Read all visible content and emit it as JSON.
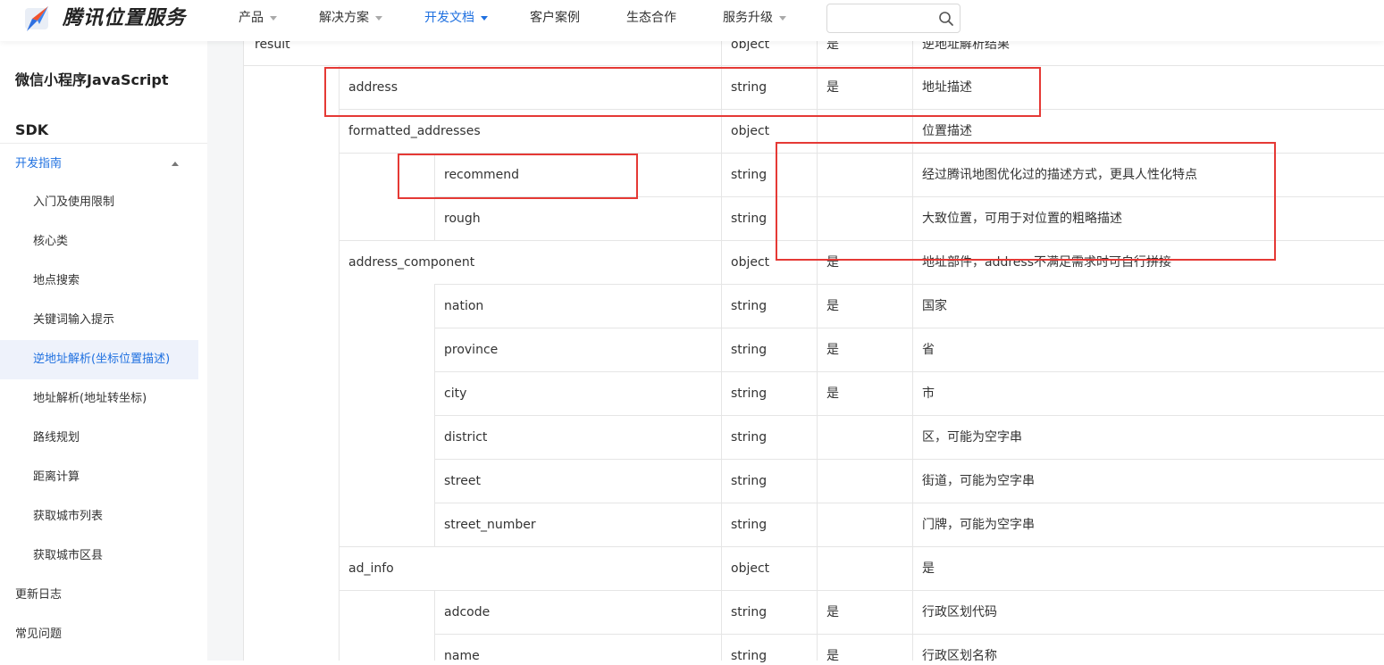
{
  "header": {
    "brand": "腾讯位置服务",
    "nav": [
      {
        "label": "产品",
        "has_caret": true,
        "active": false
      },
      {
        "label": "解决方案",
        "has_caret": true,
        "active": false
      },
      {
        "label": "开发文档",
        "has_caret": true,
        "active": true
      },
      {
        "label": "客户案例",
        "has_caret": false,
        "active": false
      },
      {
        "label": "生态合作",
        "has_caret": false,
        "active": false
      },
      {
        "label": "服务升级",
        "has_caret": true,
        "active": false
      }
    ],
    "search_placeholder": "",
    "accent_color": "#1f70e0"
  },
  "sidebar": {
    "title_line1": "微信小程序JavaScript",
    "title_line2": "SDK",
    "section": "开发指南",
    "items": [
      "入门及使用限制",
      "核心类",
      "地点搜索",
      "关键词输入提示",
      "逆地址解析(坐标位置描述)",
      "地址解析(地址转坐标)",
      "路线规划",
      "距离计算",
      "获取城市列表",
      "获取城市区县"
    ],
    "active_item": "逆地址解析(坐标位置描述)",
    "bottom_items": [
      "更新日志",
      "常见问题"
    ]
  },
  "table": {
    "rows": [
      {
        "name": "result",
        "type": "object",
        "required": "是",
        "desc": "逆地址解析结果"
      },
      {
        "name": "address",
        "type": "string",
        "required": "是",
        "desc": "地址描述"
      },
      {
        "name": "formatted_addresses",
        "type": "object",
        "required": "",
        "desc": "位置描述"
      },
      {
        "name": "recommend",
        "type": "string",
        "required": "",
        "desc": "经过腾讯地图优化过的描述方式，更具人性化特点"
      },
      {
        "name": "rough",
        "type": "string",
        "required": "",
        "desc": "大致位置，可用于对位置的粗略描述"
      },
      {
        "name": "address_component",
        "type": "object",
        "required": "是",
        "desc": "地址部件，address不满足需求时可自行拼接"
      },
      {
        "name": "nation",
        "type": "string",
        "required": "是",
        "desc": "国家"
      },
      {
        "name": "province",
        "type": "string",
        "required": "是",
        "desc": "省"
      },
      {
        "name": "city",
        "type": "string",
        "required": "是",
        "desc": "市"
      },
      {
        "name": "district",
        "type": "string",
        "required": "",
        "desc": "区，可能为空字串"
      },
      {
        "name": "street",
        "type": "string",
        "required": "",
        "desc": "街道，可能为空字串"
      },
      {
        "name": "street_number",
        "type": "string",
        "required": "",
        "desc": "门牌，可能为空字串"
      },
      {
        "name": "ad_info",
        "type": "object",
        "required": "",
        "desc": "是"
      },
      {
        "name": "adcode",
        "type": "string",
        "required": "是",
        "desc": "行政区划代码"
      },
      {
        "name": "name",
        "type": "string",
        "required": "是",
        "desc": "行政区划名称"
      }
    ]
  },
  "annotation_color": "#e53935"
}
